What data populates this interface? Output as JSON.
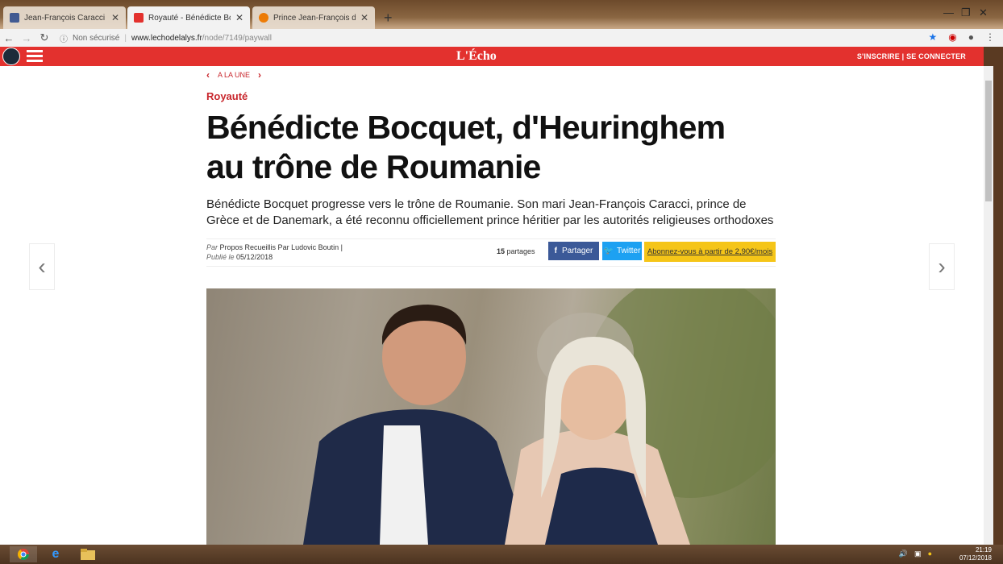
{
  "browser": {
    "tabs": [
      {
        "title": "Jean-François Caracci",
        "favicon_color": "#3b5998",
        "active": false
      },
      {
        "title": "Royauté - Bénédicte Bocquet, d'",
        "favicon_color": "#e3312e",
        "active": true
      },
      {
        "title": "Prince Jean-François de Grèce &",
        "favicon_color": "#f57d00",
        "active": false
      }
    ],
    "security_label": "Non sécurisé",
    "url_main": "www.lechodelalys.fr",
    "url_rest": "/node/7149/paywall"
  },
  "site": {
    "logo": "L'Écho",
    "auth_label": "S'INSCRIRE | SE CONNECTER",
    "brand_color": "#e3312e"
  },
  "article": {
    "breadcrumb": "A LA UNE",
    "category": "Royauté",
    "headline": "Bénédicte Bocquet, d'Heuringhem au trône de Roumanie",
    "chapo": "Bénédicte Bocquet progresse vers le trône de Roumanie. Son mari Jean-François Caracci, prince de Grèce et de Danemark, a été reconnu officiellement prince héritier par les autorités religieuses orthodoxes",
    "byline_par": "Par",
    "byline_author": "Propos Recueillis Par Ludovic Boutin |",
    "byline_published": "Publié le",
    "byline_date": "05/12/2018",
    "shares_count": "15",
    "shares_label": "partages",
    "share_facebook": "Partager",
    "share_twitter": "Twitter",
    "subscribe_label": "Abonnez-vous à partir de 2,90€/mois"
  },
  "taskbar": {
    "time": "21:19",
    "date": "07/12/2018"
  }
}
